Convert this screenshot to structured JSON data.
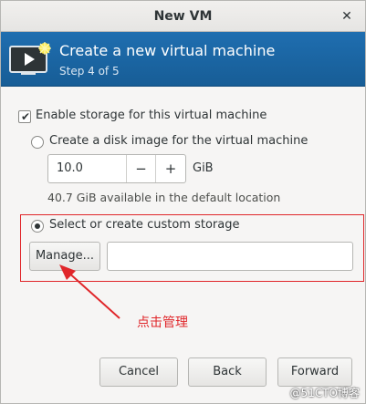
{
  "window": {
    "title": "New VM",
    "close_glyph": "✕"
  },
  "header": {
    "title": "Create a new virtual machine",
    "step": "Step 4 of 5",
    "icon": "monitor-icon"
  },
  "storage": {
    "enable_label": "Enable storage for this virtual machine",
    "enable_checked": true,
    "disk_image_label": "Create a disk image for the virtual machine",
    "disk_image_selected": false,
    "size_value": "10.0",
    "minus": "−",
    "plus": "+",
    "unit": "GiB",
    "available": "40.7 GiB available in the default location",
    "custom_label": "Select or create custom storage",
    "custom_selected": true,
    "manage_label": "Manage...",
    "path_value": ""
  },
  "annotation": {
    "text": "点击管理",
    "color": "#e0262a"
  },
  "buttons": {
    "cancel": "Cancel",
    "back": "Back",
    "forward": "Forward"
  },
  "watermark": "@51CTO博客",
  "colors": {
    "header_bg": "#1f6eb0",
    "annotation_red": "#e0262a"
  }
}
